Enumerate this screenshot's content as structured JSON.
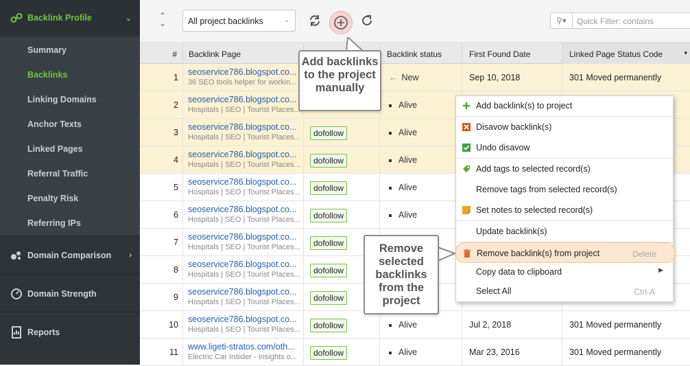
{
  "sidebar": {
    "profile": {
      "label": "Backlink Profile"
    },
    "items": [
      {
        "label": "Summary"
      },
      {
        "label": "Backlinks"
      },
      {
        "label": "Linking Domains"
      },
      {
        "label": "Anchor Texts"
      },
      {
        "label": "Linked Pages"
      },
      {
        "label": "Referral Traffic"
      },
      {
        "label": "Penalty Risk"
      },
      {
        "label": "Referring IPs"
      }
    ],
    "sections": [
      {
        "label": "Domain Comparison"
      },
      {
        "label": "Domain Strength"
      },
      {
        "label": "Reports"
      }
    ]
  },
  "toolbar": {
    "filter_select": "All project backlinks",
    "quick_filter_placeholder": "Quick Filter: contains"
  },
  "table": {
    "headers": {
      "num": "#",
      "page": "Backlink Page",
      "status": "Backlink status",
      "first_found": "First Found Date",
      "code": "Linked Page Status Code"
    },
    "rows": [
      {
        "num": "1",
        "url": "seoservice786.blogspot.co...",
        "desc": "36 SEO tools helper for workin...",
        "rel": "",
        "status": "New",
        "first": "Sep 10, 2018",
        "code": "301 Moved permanently"
      },
      {
        "num": "2",
        "url": "seoservice786.blogspot.co...",
        "desc": "Hospitals | SEO | Tourist Places...",
        "rel": "",
        "status": "Alive",
        "first": "",
        "code": ""
      },
      {
        "num": "3",
        "url": "seoservice786.blogspot.co...",
        "desc": "Hospitals | SEO | Tourist Places...",
        "rel": "dofollow",
        "status": "Alive",
        "first": "",
        "code": ""
      },
      {
        "num": "4",
        "url": "seoservice786.blogspot.co...",
        "desc": "Hospitals | SEO | Tourist Places...",
        "rel": "dofollow",
        "status": "Alive",
        "first": "",
        "code": ""
      },
      {
        "num": "5",
        "url": "seoservice786.blogspot.co...",
        "desc": "Hospitals | SEO | Tourist Places...",
        "rel": "dofollow",
        "status": "Alive",
        "first": "",
        "code": ""
      },
      {
        "num": "6",
        "url": "seoservice786.blogspot.co...",
        "desc": "Hospitals | SEO | Tourist Places...",
        "rel": "dofollow",
        "status": "Alive",
        "first": "",
        "code": ""
      },
      {
        "num": "7",
        "url": "seoservice786.blogspot.co...",
        "desc": "Hospitals | SEO | Tourist Places...",
        "rel": "dofollow",
        "status": "",
        "first": "",
        "code": ""
      },
      {
        "num": "8",
        "url": "seoservice786.blogspot.co...",
        "desc": "Hospitals | SEO | Tourist Places...",
        "rel": "dofollow",
        "status": "",
        "first": "",
        "code": ""
      },
      {
        "num": "9",
        "url": "seoservice786.blogspot.co...",
        "desc": "Hospitals | SEO | Tourist Places...",
        "rel": "dofollow",
        "status": "",
        "first": "",
        "code": ""
      },
      {
        "num": "10",
        "url": "seoservice786.blogspot.co...",
        "desc": "Hospitals | SEO | Tourist Places...",
        "rel": "dofollow",
        "status": "Alive",
        "first": "Jul 2, 2018",
        "code": "301 Moved permanently"
      },
      {
        "num": "11",
        "url": "www.ligeti-stratos.com/oth...",
        "desc": "Electric Car Insider - Insights o...",
        "rel": "dofollow",
        "status": "Alive",
        "first": "Mar 23, 2016",
        "code": "301 Moved permanently"
      }
    ]
  },
  "context_menu": {
    "items": [
      {
        "label": "Add backlink(s) to project",
        "icon": "plus-icon",
        "shortcut": ""
      },
      {
        "label": "Disavow backlink(s)",
        "icon": "disavow-icon",
        "shortcut": ""
      },
      {
        "label": "Undo disavow",
        "icon": "check-icon",
        "shortcut": ""
      },
      {
        "label": "Add tags to selected record(s)",
        "icon": "tag-icon",
        "shortcut": ""
      },
      {
        "label": "Remove tags from selected record(s)",
        "icon": "",
        "shortcut": ""
      },
      {
        "label": "Set notes to selected record(s)",
        "icon": "note-icon",
        "shortcut": ""
      },
      {
        "label": "Update backlink(s)",
        "icon": "",
        "shortcut": ""
      },
      {
        "label": "Remove backlink(s) from project",
        "icon": "trash-icon",
        "shortcut": "Delete"
      },
      {
        "label": "Copy data to clipboard",
        "icon": "",
        "shortcut": ""
      },
      {
        "label": "Select All",
        "icon": "",
        "shortcut": "Ctrl-A"
      }
    ]
  },
  "callouts": {
    "add": "Add backlinks to the project manually",
    "remove": "Remove selected backlinks from the project"
  },
  "colors": {
    "accent_green": "#74c043",
    "highlight_row": "#fbf2d3",
    "sidebar_bg": "#2e3438"
  }
}
